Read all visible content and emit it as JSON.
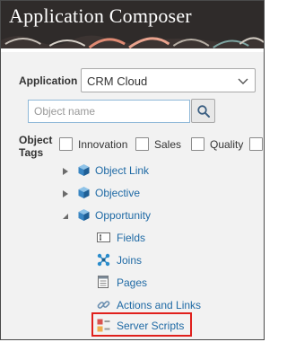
{
  "header": {
    "title": "Application Composer"
  },
  "application": {
    "label": "Application",
    "selected": "CRM Cloud"
  },
  "search": {
    "placeholder": "Object name"
  },
  "object_tags": {
    "label_line1": "Object",
    "label_line2": "Tags",
    "tags": [
      "Innovation",
      "Sales",
      "Quality"
    ]
  },
  "tree": {
    "object_link": "Object Link",
    "objective": "Objective",
    "opportunity": "Opportunity",
    "children": {
      "fields": "Fields",
      "joins": "Joins",
      "pages": "Pages",
      "actions_and_links": "Actions and Links",
      "server_scripts": "Server Scripts"
    }
  },
  "colors": {
    "link": "#1f6aa5",
    "highlight": "#e0201c",
    "header": "#2f2b2a"
  }
}
